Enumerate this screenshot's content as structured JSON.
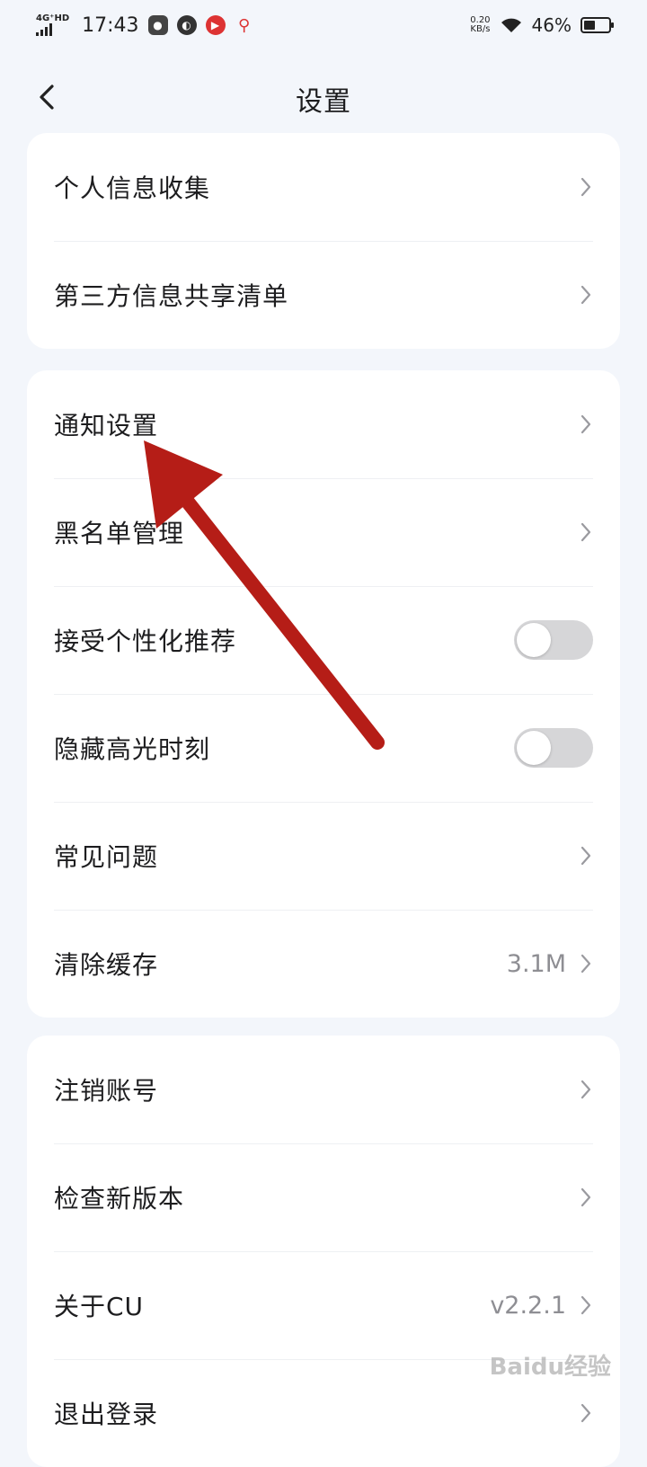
{
  "status_bar": {
    "net_top": "4G⁺HD",
    "time": "17:43",
    "speed_value": "0.20",
    "speed_unit": "KB/s",
    "battery": "46%",
    "battery_level": 0.46
  },
  "nav": {
    "title": "设置"
  },
  "card1": {
    "items": [
      {
        "label": "个人信息收集"
      },
      {
        "label": "第三方信息共享清单"
      }
    ]
  },
  "card2": {
    "items": [
      {
        "label": "通知设置"
      },
      {
        "label": "黑名单管理"
      },
      {
        "label": "接受个性化推荐",
        "toggle": false
      },
      {
        "label": "隐藏高光时刻",
        "toggle": false
      },
      {
        "label": "常见问题"
      },
      {
        "label": "清除缓存",
        "value": "3.1M"
      }
    ]
  },
  "card3": {
    "items": [
      {
        "label": "注销账号"
      },
      {
        "label": "检查新版本"
      },
      {
        "label": "关于CU",
        "value": "v2.2.1"
      },
      {
        "label": "退出登录"
      }
    ]
  },
  "watermark": "Baidu经验",
  "colors": {
    "background": "#f3f6fb",
    "card": "#ffffff",
    "annotation_arrow": "#b51d17"
  }
}
